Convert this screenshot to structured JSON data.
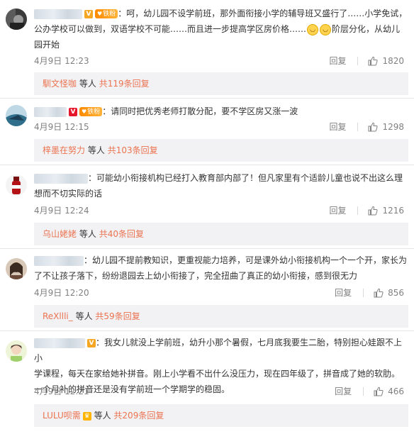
{
  "comments": [
    {
      "text_parts": [
        "：呵，幼儿园不设学前班，那外面衔接小学的辅导班又盛行了……小学免试，",
        "公办学校可以做到，双语学校不可能……而且进一步提高学区房价格……",
        "阶层分化，从幼儿",
        "园开始"
      ],
      "badge": "铁粉",
      "time": "4月9日 12:23",
      "reply_label": "回复",
      "likes": "1820",
      "replier": "馴文怪咖",
      "etc": "等人",
      "reply_count": "共119条回复"
    },
    {
      "text": "：请同时把优秀老师打散分配，要不学区房又涨一波",
      "badge": "铁粉",
      "time": "4月9日 12:15",
      "reply_label": "回复",
      "likes": "1298",
      "replier": "梓墨在努力",
      "etc": "等人",
      "reply_count": "共103条回复"
    },
    {
      "text_line1": "：可能幼小衔接机构已经打入教育部内部了！但凡家里有个适龄儿童也说不出这么理",
      "text_line2": "想而不切实际的话",
      "time": "4月9日 12:24",
      "reply_label": "回复",
      "likes": "1216",
      "replier": "乌山姥姥",
      "etc": "等人",
      "reply_count": "共40条回复"
    },
    {
      "text_line1": "：幼儿园不提前教知识，更重视能力培养，可是课外幼小衔接机构一个一个开，家长为",
      "text_line2": "了不让孩子落下，纷纷退园去上幼小衔接了，完全扭曲了真正的幼小衔接，感到很无力",
      "time": "4月9日 12:20",
      "reply_label": "回复",
      "likes": "856",
      "replier": "ReXllli_",
      "etc": "等人",
      "reply_count": "共59条回复"
    },
    {
      "text_line1": "：我女儿就没上学前班，幼升小那个暑假，七月底我要生二胎，特别担心娃跟不上小",
      "text_line2": "学课程，每天在家给她补拼音。刚上小学看不出什么没压力，现在四年级了，拼音成了她的软肋。",
      "text_line3": "一个月补的拼音还是没有学前班一个学期学的稳固。",
      "time": "4月9日 12:21",
      "reply_label": "回复",
      "likes": "466",
      "replier": "LULU呗需",
      "etc": "等人",
      "reply_count": "共209条回复"
    }
  ],
  "colors": {
    "link": "#eb7350",
    "meta": "#808080",
    "reply_bg": "#f2f2f5"
  }
}
